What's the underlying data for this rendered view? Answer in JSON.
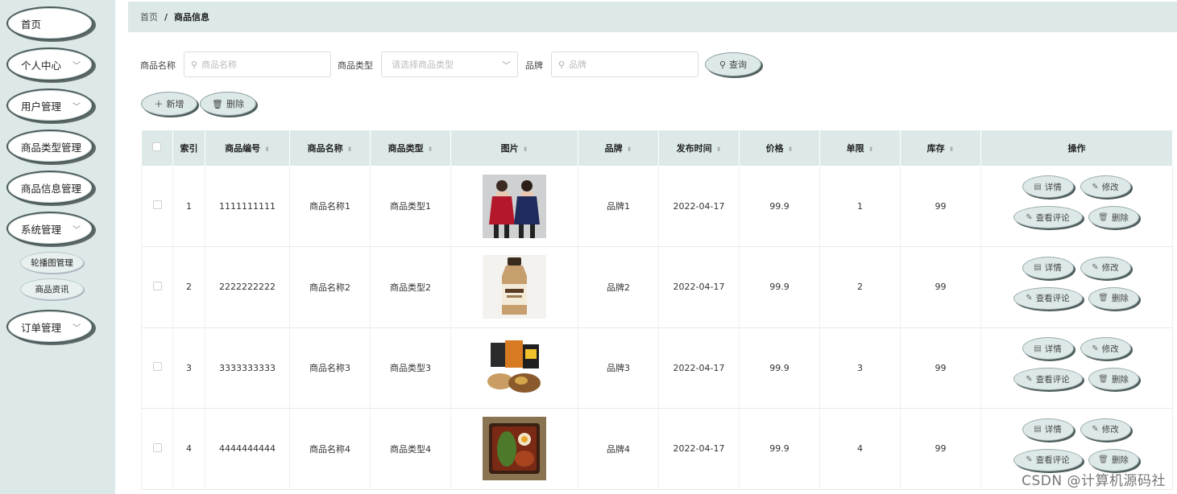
{
  "sidebar": {
    "items": [
      {
        "label": "首页",
        "has_chevron": false
      },
      {
        "label": "个人中心",
        "has_chevron": true
      },
      {
        "label": "用户管理",
        "has_chevron": true
      },
      {
        "label": "商品类型管理",
        "has_chevron": true
      },
      {
        "label": "商品信息管理",
        "has_chevron": true
      },
      {
        "label": "系统管理",
        "has_chevron": true
      },
      {
        "label": "订单管理",
        "has_chevron": true
      }
    ],
    "sub_items": [
      {
        "label": "轮播图管理"
      },
      {
        "label": "商品资讯"
      }
    ]
  },
  "breadcrumb": {
    "home": "首页",
    "separator": "/",
    "current": "商品信息"
  },
  "search": {
    "name_label": "商品名称",
    "name_placeholder": "商品名称",
    "type_label": "商品类型",
    "type_placeholder": "请选择商品类型",
    "brand_label": "品牌",
    "brand_placeholder": "品牌",
    "query_button": "查询"
  },
  "actions": {
    "add": "新增",
    "delete": "删除"
  },
  "table": {
    "headers": [
      "索引",
      "商品编号",
      "商品名称",
      "商品类型",
      "图片",
      "品牌",
      "发布时间",
      "价格",
      "单限",
      "库存",
      "操作"
    ],
    "rows": [
      {
        "index": "1",
        "code": "1111111111",
        "name": "商品名称1",
        "type": "商品类型1",
        "image": "clothing",
        "brand": "品牌1",
        "date": "2022-04-17",
        "price": "99.9",
        "limit": "1",
        "stock": "99"
      },
      {
        "index": "2",
        "code": "2222222222",
        "name": "商品名称2",
        "type": "商品类型2",
        "image": "bottle",
        "brand": "品牌2",
        "date": "2022-04-17",
        "price": "99.9",
        "limit": "2",
        "stock": "99"
      },
      {
        "index": "3",
        "code": "3333333333",
        "name": "商品名称3",
        "type": "商品类型3",
        "image": "snacks",
        "brand": "品牌3",
        "date": "2022-04-17",
        "price": "99.9",
        "limit": "3",
        "stock": "99"
      },
      {
        "index": "4",
        "code": "4444444444",
        "name": "商品名称4",
        "type": "商品类型4",
        "image": "food-box",
        "brand": "品牌4",
        "date": "2022-04-17",
        "price": "99.9",
        "limit": "4",
        "stock": "99"
      }
    ],
    "row_actions": {
      "detail": "详情",
      "edit": "修改",
      "comments": "查看评论",
      "delete": "删除"
    }
  },
  "watermark": "CSDN @计算机源码社",
  "colors": {
    "accent_bg": "#dce9e8",
    "pill_border": "#4d5c5b"
  }
}
